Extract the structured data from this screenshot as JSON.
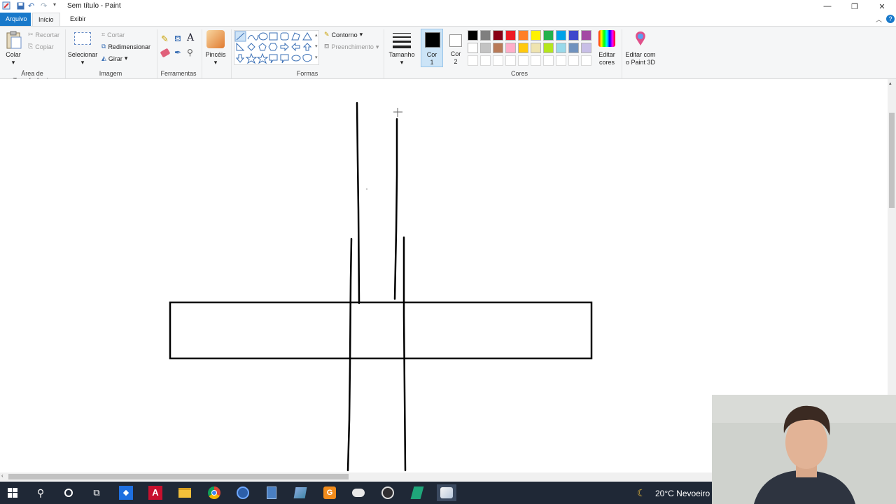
{
  "window": {
    "title": "Sem título - Paint",
    "minimize_icon": "minimize-icon",
    "restore_icon": "restore-icon",
    "close_icon": "close-icon"
  },
  "tabs": {
    "file": "Arquivo",
    "home": "Início",
    "view": "Exibir"
  },
  "clipboard": {
    "paste": "Colar",
    "cut": "Recortar",
    "copy": "Copiar",
    "group": "Área de Transferência"
  },
  "image": {
    "select": "Selecionar",
    "crop": "Cortar",
    "resize": "Redimensionar",
    "rotate": "Girar",
    "group": "Imagem"
  },
  "tools": {
    "group": "Ferramentas"
  },
  "brushes": {
    "label": "Pincéis"
  },
  "shapes": {
    "outline": "Contorno",
    "fill": "Preenchimento",
    "group": "Formas"
  },
  "size": {
    "label": "Tamanho"
  },
  "colors": {
    "color1_line1": "Cor",
    "color1_line2": "1",
    "color2_line1": "Cor",
    "color2_line2": "2",
    "edit_line1": "Editar",
    "edit_line2": "cores",
    "group": "Cores",
    "paint3d_line1": "Editar com",
    "paint3d_line2": "o Paint 3D",
    "color1_value": "#000000",
    "color2_value": "#ffffff",
    "palette_row1": [
      "#000000",
      "#7f7f7f",
      "#880015",
      "#ed1c24",
      "#ff7f27",
      "#fff200",
      "#22b14c",
      "#00a2e8",
      "#3f48cc",
      "#a349a4"
    ],
    "palette_row2": [
      "#ffffff",
      "#c3c3c3",
      "#b97a57",
      "#ffaec9",
      "#ffc90e",
      "#efe4b0",
      "#b5e61d",
      "#99d9ea",
      "#7092be",
      "#c8bfe7"
    ]
  },
  "taskbar": {
    "weather": "20°C  Nevoeiro",
    "icons": [
      "windows-start-icon",
      "search-icon",
      "cortana-icon",
      "task-view-icon",
      "dropbox-icon",
      "autocad-icon",
      "file-explorer-icon",
      "chrome-icon",
      "app-blue-icon",
      "calculator-icon",
      "app-tile-icon",
      "app-orange-icon",
      "app-cloud-icon",
      "obs-icon",
      "app-green-icon",
      "paint-icon"
    ]
  }
}
